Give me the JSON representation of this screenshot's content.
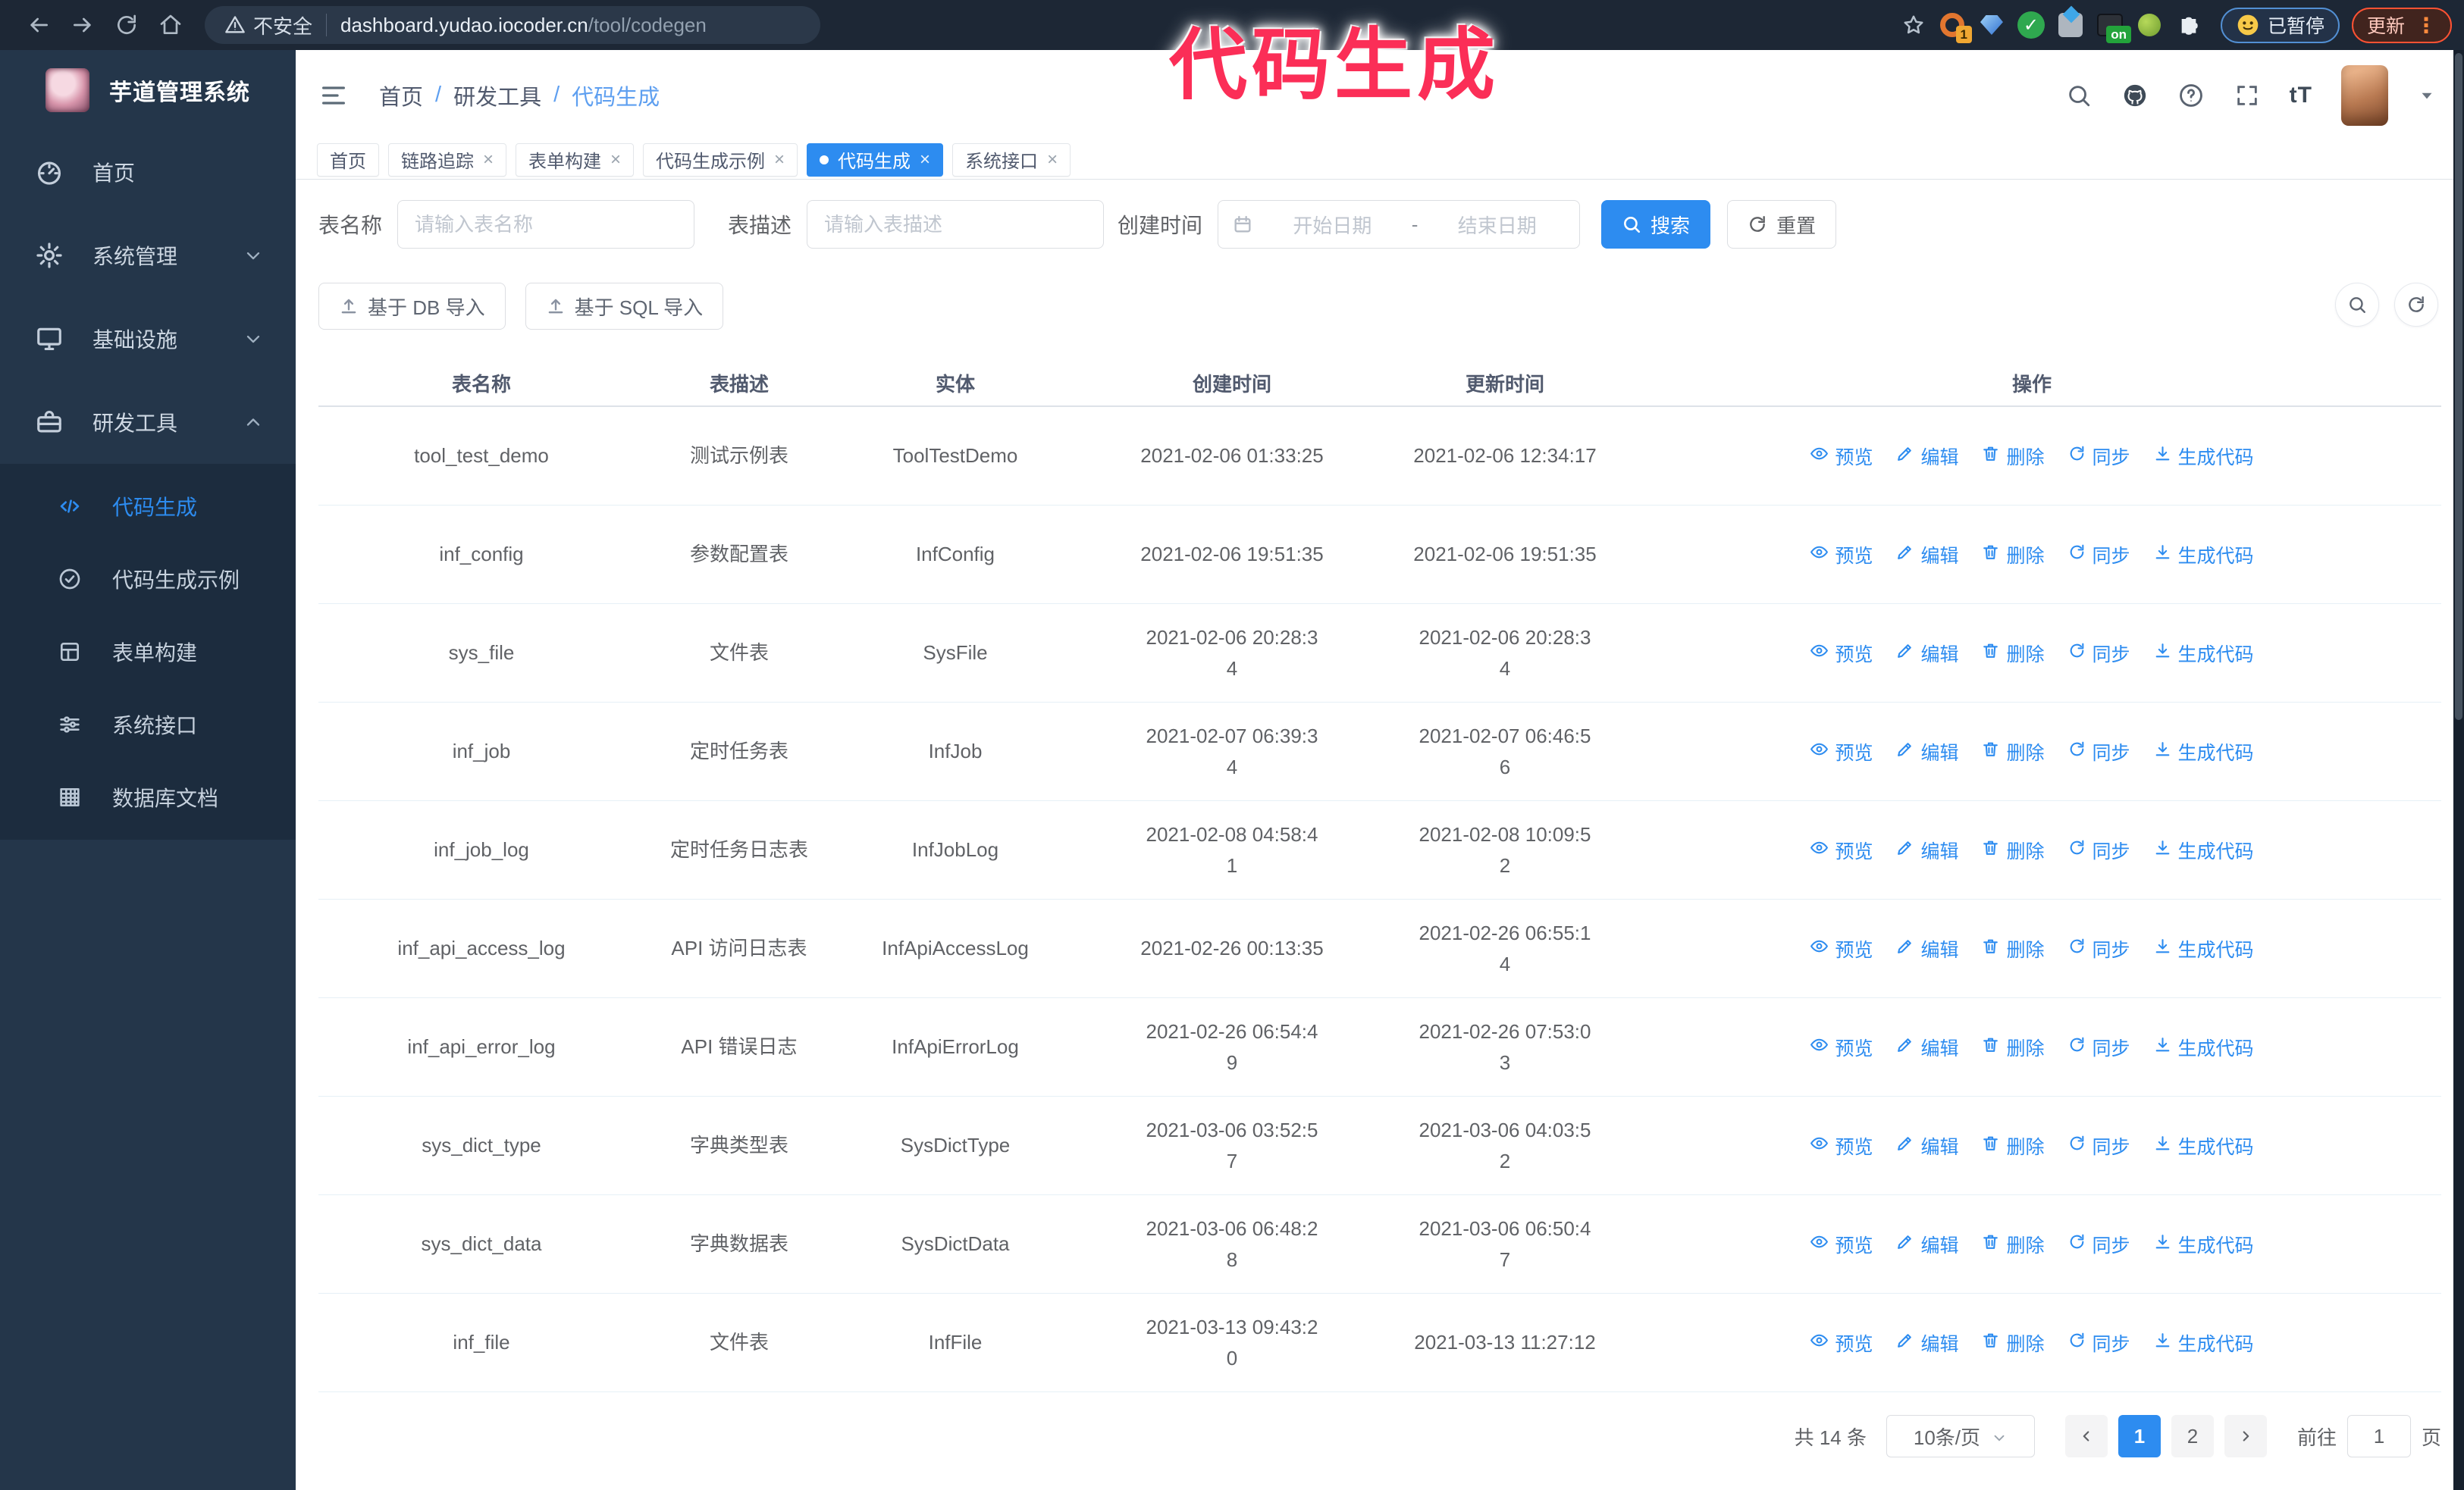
{
  "browser": {
    "security_label": "不安全",
    "url_host": "dashboard.yudao.iocoder.cn",
    "url_path": "/tool/codegen",
    "paused_badge": "已暂停",
    "update_button": "更新",
    "kebab": "⋮",
    "extensions": [
      {
        "icon": "color-wheel-extension-icon",
        "badge": "1"
      },
      {
        "icon": "gem-extension-icon"
      },
      {
        "icon": "check-extension-icon",
        "glyph": "✓"
      },
      {
        "icon": "tabs-extension-icon"
      },
      {
        "icon": "dark-extension-icon",
        "badge": "on"
      },
      {
        "icon": "key-extension-icon"
      },
      {
        "icon": "puzzle-extension-icon"
      }
    ]
  },
  "annotation": {
    "text": "代码生成",
    "color": "#fb2e57"
  },
  "sidebar": {
    "title": "芋道管理系统",
    "items": [
      {
        "label": "首页",
        "icon": "dashboard-icon",
        "chevron": ""
      },
      {
        "label": "系统管理",
        "icon": "gear-icon",
        "chevron": "down"
      },
      {
        "label": "基础设施",
        "icon": "monitor-icon",
        "chevron": "down"
      },
      {
        "label": "研发工具",
        "icon": "toolbox-icon",
        "chevron": "up"
      }
    ],
    "subitems": [
      {
        "label": "代码生成",
        "icon": "code-icon",
        "active": true
      },
      {
        "label": "代码生成示例",
        "icon": "badge-check-icon",
        "active": false
      },
      {
        "label": "表单构建",
        "icon": "form-grid-icon",
        "active": false
      },
      {
        "label": "系统接口",
        "icon": "sliders-icon",
        "active": false
      },
      {
        "label": "数据库文档",
        "icon": "database-rows-icon",
        "active": false
      }
    ]
  },
  "breadcrumb": [
    "首页",
    "研发工具",
    "代码生成"
  ],
  "tabs": [
    {
      "label": "首页",
      "closable": false,
      "active": false
    },
    {
      "label": "链路追踪",
      "closable": true,
      "active": false
    },
    {
      "label": "表单构建",
      "closable": true,
      "active": false
    },
    {
      "label": "代码生成示例",
      "closable": true,
      "active": false
    },
    {
      "label": "代码生成",
      "closable": true,
      "active": true
    },
    {
      "label": "系统接口",
      "closable": true,
      "active": false
    }
  ],
  "filters": {
    "name_label": "表名称",
    "name_placeholder": "请输入表名称",
    "desc_label": "表描述",
    "desc_placeholder": "请输入表描述",
    "time_label": "创建时间",
    "start_placeholder": "开始日期",
    "range_separator": "-",
    "end_placeholder": "结束日期",
    "search_label": "搜索",
    "reset_label": "重置"
  },
  "toolbar": {
    "db_import": "基于 DB 导入",
    "sql_import": "基于 SQL 导入"
  },
  "table": {
    "columns": [
      "表名称",
      "表描述",
      "实体",
      "创建时间",
      "更新时间",
      "操作"
    ],
    "actions": [
      "预览",
      "编辑",
      "删除",
      "同步",
      "生成代码"
    ],
    "action_icons": [
      "eye-icon",
      "edit-icon",
      "trash-icon",
      "sync-icon",
      "download-icon"
    ],
    "rows": [
      {
        "name": "tool_test_demo",
        "desc": "测试示例表",
        "entity": "ToolTestDemo",
        "created": "2021-02-06 01:33:25",
        "updated": "2021-02-06 12:34:17"
      },
      {
        "name": "inf_config",
        "desc": "参数配置表",
        "entity": "InfConfig",
        "created": "2021-02-06 19:51:35",
        "updated": "2021-02-06 19:51:35"
      },
      {
        "name": "sys_file",
        "desc": "文件表",
        "entity": "SysFile",
        "created": "2021-02-06 20:28:3\n4",
        "updated": "2021-02-06 20:28:3\n4"
      },
      {
        "name": "inf_job",
        "desc": "定时任务表",
        "entity": "InfJob",
        "created": "2021-02-07 06:39:3\n4",
        "updated": "2021-02-07 06:46:5\n6"
      },
      {
        "name": "inf_job_log",
        "desc": "定时任务日志表",
        "entity": "InfJobLog",
        "created": "2021-02-08 04:58:4\n1",
        "updated": "2021-02-08 10:09:5\n2"
      },
      {
        "name": "inf_api_access_log",
        "desc": "API 访问日志表",
        "entity": "InfApiAccessLog",
        "created": "2021-02-26 00:13:35",
        "updated": "2021-02-26 06:55:1\n4"
      },
      {
        "name": "inf_api_error_log",
        "desc": "API 错误日志",
        "entity": "InfApiErrorLog",
        "created": "2021-02-26 06:54:4\n9",
        "updated": "2021-02-26 07:53:0\n3"
      },
      {
        "name": "sys_dict_type",
        "desc": "字典类型表",
        "entity": "SysDictType",
        "created": "2021-03-06 03:52:5\n7",
        "updated": "2021-03-06 04:03:5\n2"
      },
      {
        "name": "sys_dict_data",
        "desc": "字典数据表",
        "entity": "SysDictData",
        "created": "2021-03-06 06:48:2\n8",
        "updated": "2021-03-06 06:50:4\n7"
      },
      {
        "name": "inf_file",
        "desc": "文件表",
        "entity": "InfFile",
        "created": "2021-03-13 09:43:2\n0",
        "updated": "2021-03-13 11:27:12"
      }
    ]
  },
  "pagination": {
    "total": "共 14 条",
    "page_size": "10条/页",
    "pages": [
      "1",
      "2"
    ],
    "active_page": "1",
    "goto_label": "前往",
    "goto_value": "1",
    "page_label": "页"
  }
}
